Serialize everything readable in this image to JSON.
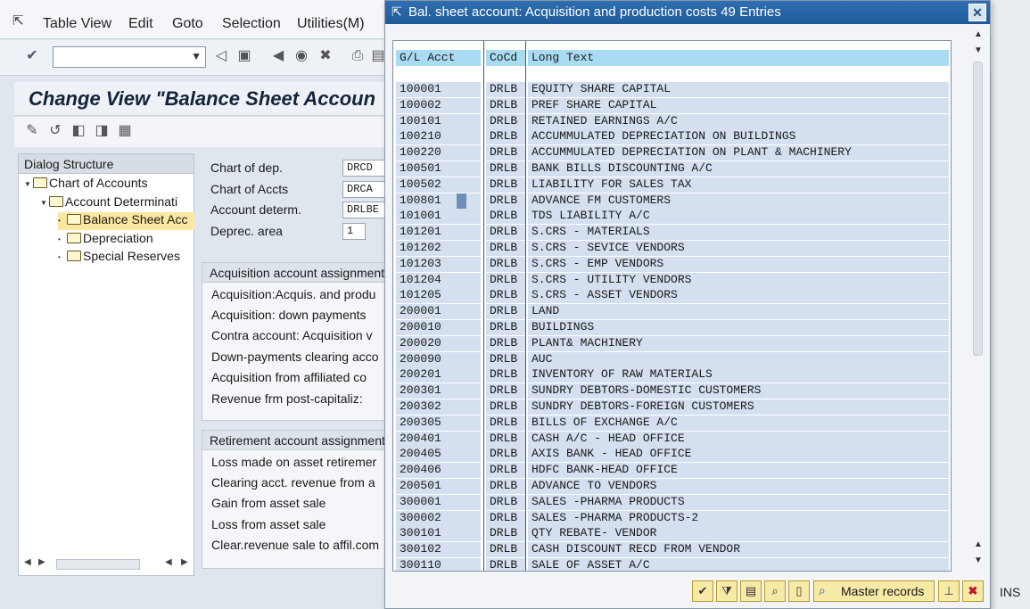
{
  "menubar": {
    "items": [
      "Table View",
      "Edit",
      "Goto",
      "Selection",
      "Utilities(M)"
    ]
  },
  "view_title": "Change View \"Balance Sheet Accoun",
  "dialog_structure": {
    "header": "Dialog Structure",
    "items": [
      {
        "label": "Chart of Accounts"
      },
      {
        "label": "Account Determinati"
      },
      {
        "label": "Balance Sheet Acc"
      },
      {
        "label": "Depreciation"
      },
      {
        "label": "Special Reserves"
      }
    ]
  },
  "fields": [
    {
      "label": "Chart of dep.",
      "value": "DRCD"
    },
    {
      "label": "Chart of Accts",
      "value": "DRCA"
    },
    {
      "label": "Account determ.",
      "value": "DRLBE"
    },
    {
      "label": "Deprec. area",
      "value": "1"
    }
  ],
  "acq_group": {
    "header": "Acquisition account assignment",
    "rows": [
      "Acquisition:Acquis. and produ",
      "Acquisition: down payments",
      "Contra account: Acquisition v",
      "Down-payments clearing acco",
      "Acquisition from affiliated co",
      "Revenue frm post-capitaliz:"
    ]
  },
  "ret_group": {
    "header": "Retirement account assignment",
    "rows": [
      "Loss made on asset retiremer",
      "Clearing acct. revenue from a",
      "Gain from asset sale",
      "Loss from asset sale",
      "Clear.revenue sale to affil.com"
    ]
  },
  "popup": {
    "title": "Bal. sheet account: Acquisition and production costs 49 Entries",
    "columns": [
      "G/L Acct",
      "CoCd",
      "Long Text"
    ],
    "rows": [
      {
        "acct": "100001",
        "cocd": "DRLB",
        "text": "EQUITY SHARE CAPITAL"
      },
      {
        "acct": "100002",
        "cocd": "DRLB",
        "text": "PREF SHARE CAPITAL"
      },
      {
        "acct": "100101",
        "cocd": "DRLB",
        "text": "RETAINED EARNINGS A/C"
      },
      {
        "acct": "100210",
        "cocd": "DRLB",
        "text": "ACCUMMULATED DEPRECIATION  ON BUILDINGS"
      },
      {
        "acct": "100220",
        "cocd": "DRLB",
        "text": "ACCUMMULATED DEPRECIATION  ON PLANT & MACHINERY"
      },
      {
        "acct": "100501",
        "cocd": "DRLB",
        "text": "BANK BILLS DISCOUNTING A/C"
      },
      {
        "acct": "100502",
        "cocd": "DRLB",
        "text": "LIABILITY FOR SALES TAX"
      },
      {
        "acct": "100801",
        "cocd": "DRLB",
        "text": "ADVANCE FM CUSTOMERS"
      },
      {
        "acct": "101001",
        "cocd": "DRLB",
        "text": "TDS LIABILITY A/C"
      },
      {
        "acct": "101201",
        "cocd": "DRLB",
        "text": "S.CRS - MATERIALS"
      },
      {
        "acct": "101202",
        "cocd": "DRLB",
        "text": "S.CRS - SEVICE  VENDORS"
      },
      {
        "acct": "101203",
        "cocd": "DRLB",
        "text": "S.CRS - EMP VENDORS"
      },
      {
        "acct": "101204",
        "cocd": "DRLB",
        "text": "S.CRS - UTILITY VENDORS"
      },
      {
        "acct": "101205",
        "cocd": "DRLB",
        "text": "S.CRS - ASSET VENDORS"
      },
      {
        "acct": "200001",
        "cocd": "DRLB",
        "text": "LAND"
      },
      {
        "acct": "200010",
        "cocd": "DRLB",
        "text": "BUILDINGS"
      },
      {
        "acct": "200020",
        "cocd": "DRLB",
        "text": "PLANT& MACHINERY"
      },
      {
        "acct": "200090",
        "cocd": "DRLB",
        "text": "AUC"
      },
      {
        "acct": "200201",
        "cocd": "DRLB",
        "text": "INVENTORY OF RAW MATERIALS"
      },
      {
        "acct": "200301",
        "cocd": "DRLB",
        "text": "SUNDRY DEBTORS-DOMESTIC CUSTOMERS"
      },
      {
        "acct": "200302",
        "cocd": "DRLB",
        "text": "SUNDRY DEBTORS-FOREIGN  CUSTOMERS"
      },
      {
        "acct": "200305",
        "cocd": "DRLB",
        "text": "BILLS OF EXCHANGE A/C"
      },
      {
        "acct": "200401",
        "cocd": "DRLB",
        "text": "CASH A/C - HEAD OFFICE"
      },
      {
        "acct": "200405",
        "cocd": "DRLB",
        "text": "AXIS BANK - HEAD OFFICE"
      },
      {
        "acct": "200406",
        "cocd": "DRLB",
        "text": "HDFC BANK-HEAD OFFICE"
      },
      {
        "acct": "200501",
        "cocd": "DRLB",
        "text": "ADVANCE TO VENDORS"
      },
      {
        "acct": "300001",
        "cocd": "DRLB",
        "text": "SALES -PHARMA PRODUCTS"
      },
      {
        "acct": "300002",
        "cocd": "DRLB",
        "text": "SALES -PHARMA PRODUCTS-2"
      },
      {
        "acct": "300101",
        "cocd": "DRLB",
        "text": "QTY  REBATE- VENDOR"
      },
      {
        "acct": "300102",
        "cocd": "DRLB",
        "text": "CASH DISCOUNT RECD FROM VENDOR"
      },
      {
        "acct": "300110",
        "cocd": "DRLB",
        "text": "SALE OF ASSET A/C"
      }
    ],
    "master_records_label": "Master records"
  },
  "status": {
    "mode": "INS"
  },
  "colors": {
    "title_bar": "#1f5a98",
    "column_header": "#a9dcf2",
    "row_bg": "#d4e0ef",
    "button_bg": "#f7e9a6"
  }
}
